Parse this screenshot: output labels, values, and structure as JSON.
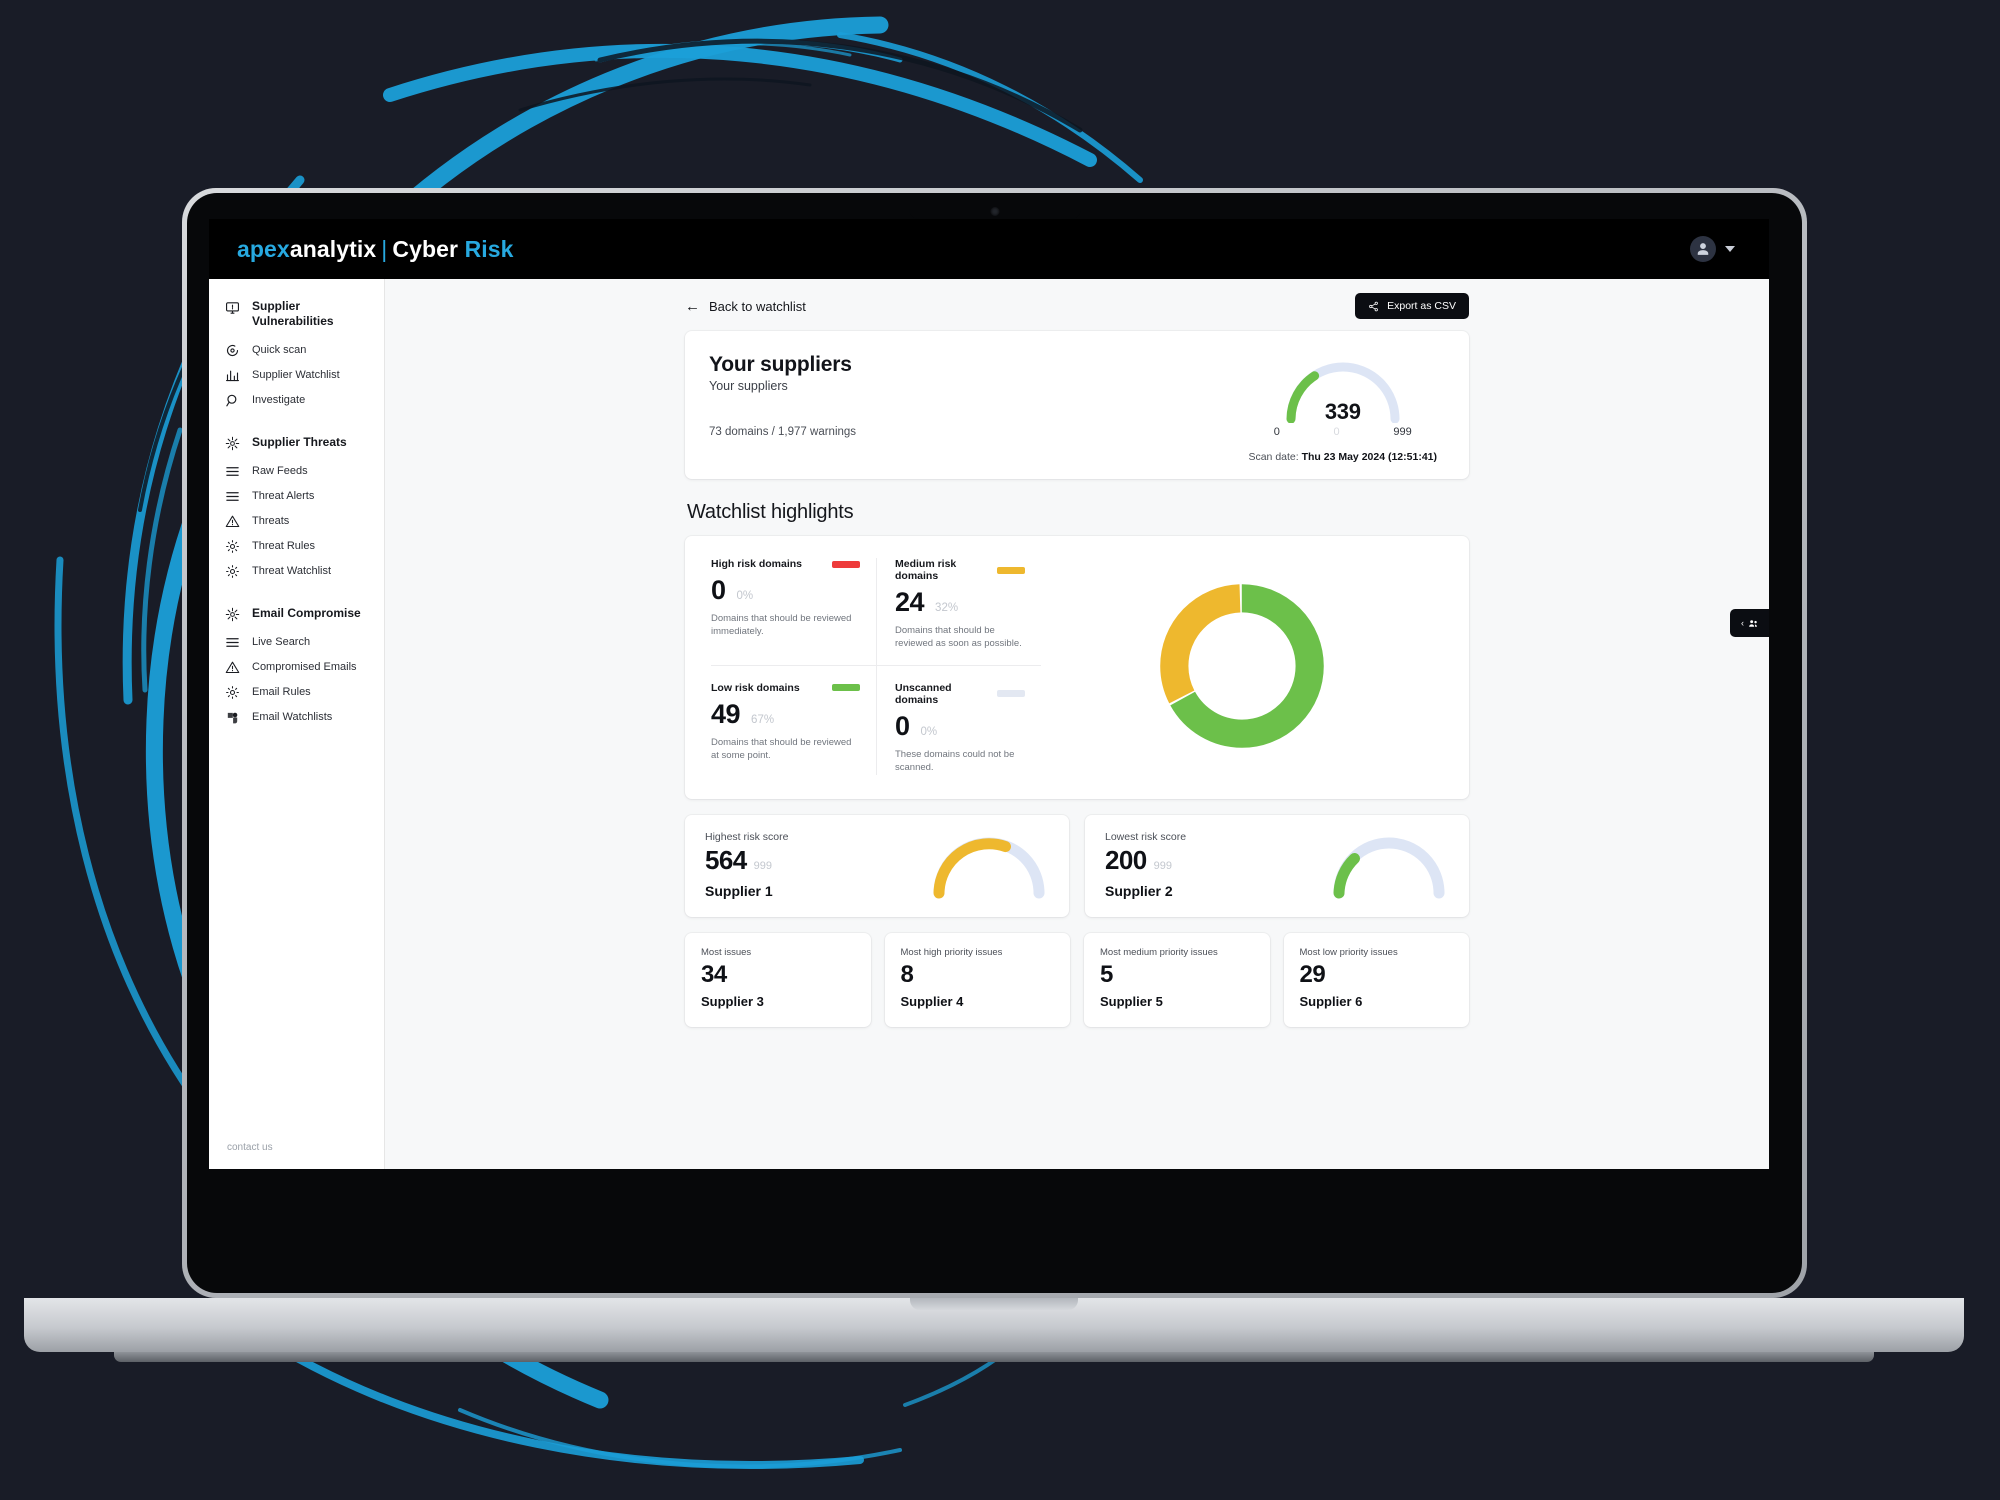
{
  "brand": {
    "apex": "apex",
    "analytix": "analytix",
    "separator": "|",
    "cyber": "Cyber",
    "risk": "Risk"
  },
  "colors": {
    "accent": "#27a9e0",
    "high_risk": "#ee3b3b",
    "medium_risk": "#eeb82e",
    "low_risk": "#6cc04a",
    "unscanned": "#e3e8f2",
    "gauge_track": "#dde5f5",
    "dark": "#0b0d12"
  },
  "sidebar": {
    "groups": [
      {
        "title": "Supplier Vulnerabilities",
        "icon": "vulnerability-icon",
        "items": [
          {
            "label": "Quick scan",
            "icon": "quick-scan-icon"
          },
          {
            "label": "Supplier Watchlist",
            "icon": "chart-bars-icon"
          },
          {
            "label": "Investigate",
            "icon": "search-icon"
          }
        ]
      },
      {
        "title": "Supplier Threats",
        "icon": "threat-icon",
        "items": [
          {
            "label": "Raw Feeds",
            "icon": "list-icon"
          },
          {
            "label": "Threat Alerts",
            "icon": "list-icon"
          },
          {
            "label": "Threats",
            "icon": "warning-triangle-icon"
          },
          {
            "label": "Threat Rules",
            "icon": "gear-icon"
          },
          {
            "label": "Threat Watchlist",
            "icon": "gear-icon"
          }
        ]
      },
      {
        "title": "Email Compromise",
        "icon": "threat-icon",
        "items": [
          {
            "label": "Live Search",
            "icon": "list-icon"
          },
          {
            "label": "Compromised Emails",
            "icon": "warning-triangle-icon"
          },
          {
            "label": "Email Rules",
            "icon": "gear-icon"
          },
          {
            "label": "Email Watchlists",
            "icon": "watchlist-icon"
          }
        ]
      }
    ],
    "contact": "contact us"
  },
  "toolbar": {
    "back_label": "Back to watchlist",
    "export_label": "Export as CSV"
  },
  "summary": {
    "title": "Your suppliers",
    "subtitle": "Your suppliers",
    "domains_line": "73 domains / 1,977 warnings",
    "score": "339",
    "scale_min": "0",
    "scale_mid": "0",
    "scale_max": "999",
    "scan_date_label": "Scan date:",
    "scan_date_value": "Thu 23 May 2024 (12:51:41)"
  },
  "highlights": {
    "section_title": "Watchlist highlights",
    "cells": [
      {
        "label": "High risk domains",
        "value": "0",
        "percent": "0%",
        "desc": "Domains that should be reviewed immediately.",
        "color": "#ee3b3b"
      },
      {
        "label": "Medium risk domains",
        "value": "24",
        "percent": "32%",
        "desc": "Domains that should be reviewed as soon as possible.",
        "color": "#eeb82e"
      },
      {
        "label": "Low risk domains",
        "value": "49",
        "percent": "67%",
        "desc": "Domains that should be reviewed at some point.",
        "color": "#6cc04a"
      },
      {
        "label": "Unscanned domains",
        "value": "0",
        "percent": "0%",
        "desc": "These domains could not be scanned.",
        "color": "#e3e8f2"
      }
    ]
  },
  "score_cards": [
    {
      "label": "Highest risk score",
      "value": "564",
      "max": "999",
      "supplier": "Supplier 1",
      "color": "#eeb82e"
    },
    {
      "label": "Lowest risk score",
      "value": "200",
      "max": "999",
      "supplier": "Supplier 2",
      "color": "#6cc04a"
    }
  ],
  "issue_cards": [
    {
      "label": "Most issues",
      "value": "34",
      "supplier": "Supplier 3"
    },
    {
      "label": "Most high priority issues",
      "value": "8",
      "supplier": "Supplier 4"
    },
    {
      "label": "Most medium priority issues",
      "value": "5",
      "supplier": "Supplier 5"
    },
    {
      "label": "Most low priority issues",
      "value": "29",
      "supplier": "Supplier 6"
    }
  ],
  "chart_data": [
    {
      "type": "pie",
      "title": "Watchlist highlights domain risk breakdown",
      "labels": [
        "High risk domains",
        "Medium risk domains",
        "Low risk domains",
        "Unscanned domains"
      ],
      "values": [
        0,
        24,
        49,
        0
      ],
      "percents": [
        0,
        32,
        67,
        0
      ],
      "colors": [
        "#ee3b3b",
        "#eeb82e",
        "#6cc04a",
        "#e3e8f2"
      ],
      "legend": "left"
    },
    {
      "type": "gauge",
      "title": "Your suppliers risk score",
      "value": 339,
      "min": 0,
      "max": 999,
      "color": "#6cc04a",
      "track": "#dde5f5"
    },
    {
      "type": "gauge",
      "title": "Highest risk score",
      "value": 564,
      "min": 0,
      "max": 999,
      "color": "#eeb82e",
      "track": "#dde5f5"
    },
    {
      "type": "gauge",
      "title": "Lowest risk score",
      "value": 200,
      "min": 0,
      "max": 999,
      "color": "#6cc04a",
      "track": "#dde5f5"
    }
  ]
}
